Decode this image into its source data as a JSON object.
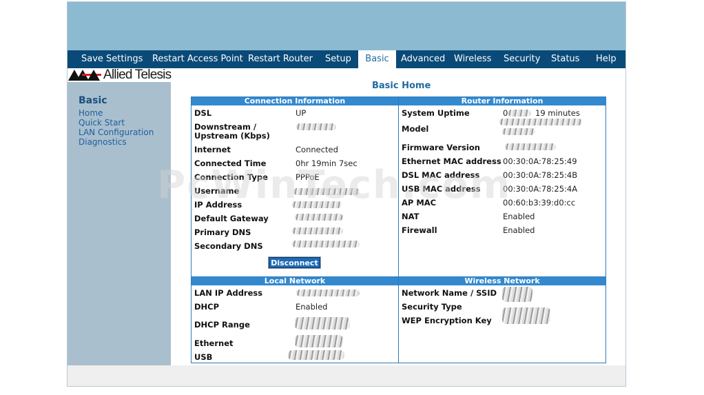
{
  "nav": {
    "items": [
      "Save Settings",
      "Restart Access Point",
      "Restart Router",
      "Setup",
      "Basic",
      "Advanced",
      "Wireless",
      "Security",
      "Status",
      "Help"
    ],
    "active": "Basic"
  },
  "brand": {
    "logo_text": "Allied Telesis"
  },
  "sidebar": {
    "title": "Basic",
    "links": [
      "Home",
      "Quick Start",
      "LAN Configuration",
      "Diagnostics"
    ]
  },
  "page": {
    "title": "Basic Home"
  },
  "watermark": "PcWinTech.com",
  "connection": {
    "header": "Connection Information",
    "rows": [
      {
        "label": "DSL",
        "value": "UP"
      },
      {
        "label": "Downstream /",
        "label2": "Upstream (Kbps)",
        "value": ""
      },
      {
        "label": "Internet",
        "value": "Connected"
      },
      {
        "label": "Connected Time",
        "value": "0hr 19min 7sec"
      },
      {
        "label": "Connection Type",
        "value": "PPPoE"
      },
      {
        "label": "Username",
        "value": ""
      },
      {
        "label": "IP Address",
        "value": ""
      },
      {
        "label": "Default Gateway",
        "value": ""
      },
      {
        "label": "Primary DNS",
        "value": ""
      },
      {
        "label": "Secondary DNS",
        "value": ""
      }
    ],
    "button": "Disconnect"
  },
  "router": {
    "header": "Router Information",
    "uptime_partial": "0",
    "uptime_suffix": "19 minutes",
    "rows": [
      {
        "label": "System Uptime",
        "value": ""
      },
      {
        "label": "Model",
        "value": ""
      },
      {
        "label": "Firmware Version",
        "value": ""
      },
      {
        "label": "Ethernet MAC address",
        "value": "00:30:0A:78:25:49"
      },
      {
        "label": "DSL MAC address",
        "value": "00:30:0A:78:25:4B"
      },
      {
        "label": "USB MAC address",
        "value": "00:30:0A:78:25:4A"
      },
      {
        "label": "AP MAC",
        "value": "00:60:b3:39:d0:cc"
      },
      {
        "label": "NAT",
        "value": "Enabled"
      },
      {
        "label": "Firewall",
        "value": "Enabled"
      }
    ]
  },
  "local": {
    "header": "Local Network",
    "rows": [
      {
        "label": "LAN IP Address",
        "value": ""
      },
      {
        "label": "DHCP",
        "value": "Enabled"
      },
      {
        "label": "DHCP Range",
        "value": ""
      },
      {
        "label": "Ethernet",
        "value": ""
      },
      {
        "label": "USB",
        "value": ""
      }
    ]
  },
  "wireless": {
    "header": "Wireless Network",
    "rows": [
      {
        "label": "Network Name / SSID",
        "value": ""
      },
      {
        "label": "Security Type",
        "value": ""
      },
      {
        "label": "WEP Encryption Key",
        "value": ""
      }
    ]
  }
}
